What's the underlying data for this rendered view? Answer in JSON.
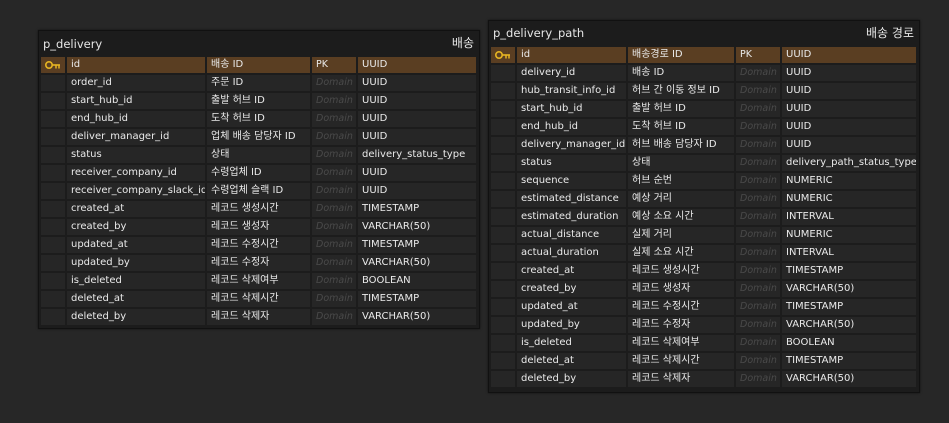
{
  "tables": [
    {
      "name": "p_delivery",
      "comment": "배송",
      "columns": [
        {
          "name": "id",
          "comment": "배송 ID",
          "key": "PK",
          "type": "UUID",
          "pk": true
        },
        {
          "name": "order_id",
          "comment": "주문 ID",
          "key": "Domain",
          "type": "UUID"
        },
        {
          "name": "start_hub_id",
          "comment": "출발 허브 ID",
          "key": "Domain",
          "type": "UUID"
        },
        {
          "name": "end_hub_id",
          "comment": "도착 허브 ID",
          "key": "Domain",
          "type": "UUID"
        },
        {
          "name": "deliver_manager_id",
          "comment": "업체 배송 담당자 ID",
          "key": "Domain",
          "type": "UUID"
        },
        {
          "name": "status",
          "comment": "상태",
          "key": "Domain",
          "type": "delivery_status_type"
        },
        {
          "name": "receiver_company_id",
          "comment": "수령업체 ID",
          "key": "Domain",
          "type": "UUID"
        },
        {
          "name": "receiver_company_slack_id",
          "comment": "수령업체 슬랙 ID",
          "key": "Domain",
          "type": "UUID"
        },
        {
          "name": "created_at",
          "comment": "레코드 생성시간",
          "key": "Domain",
          "type": "TIMESTAMP"
        },
        {
          "name": "created_by",
          "comment": "레코드 생성자",
          "key": "Domain",
          "type": "VARCHAR(50)"
        },
        {
          "name": "updated_at",
          "comment": "레코드 수정시간",
          "key": "Domain",
          "type": "TIMESTAMP"
        },
        {
          "name": "updated_by",
          "comment": "레코드 수정자",
          "key": "Domain",
          "type": "VARCHAR(50)"
        },
        {
          "name": "is_deleted",
          "comment": "레코드 삭제여부",
          "key": "Domain",
          "type": "BOOLEAN"
        },
        {
          "name": "deleted_at",
          "comment": "레코드 삭제시간",
          "key": "Domain",
          "type": "TIMESTAMP"
        },
        {
          "name": "deleted_by",
          "comment": "레코드 삭제자",
          "key": "Domain",
          "type": "VARCHAR(50)"
        }
      ]
    },
    {
      "name": "p_delivery_path",
      "comment": "배송 경로",
      "columns": [
        {
          "name": "id",
          "comment": "배송경로 ID",
          "key": "PK",
          "type": "UUID",
          "pk": true
        },
        {
          "name": "delivery_id",
          "comment": "배송 ID",
          "key": "Domain",
          "type": "UUID"
        },
        {
          "name": "hub_transit_info_id",
          "comment": "허브 간 이동 정보 ID",
          "key": "Domain",
          "type": "UUID"
        },
        {
          "name": "start_hub_id",
          "comment": "출발 허브 ID",
          "key": "Domain",
          "type": "UUID"
        },
        {
          "name": "end_hub_id",
          "comment": "도착 허브 ID",
          "key": "Domain",
          "type": "UUID"
        },
        {
          "name": "delivery_manager_id",
          "comment": "허브 배송 담당자 ID",
          "key": "Domain",
          "type": "UUID"
        },
        {
          "name": "status",
          "comment": "상태",
          "key": "Domain",
          "type": "delivery_path_status_type"
        },
        {
          "name": "sequence",
          "comment": "허브 순번",
          "key": "Domain",
          "type": "NUMERIC"
        },
        {
          "name": "estimated_distance",
          "comment": "예상 거리",
          "key": "Domain",
          "type": "NUMERIC"
        },
        {
          "name": "estimated_duration",
          "comment": "예상 소요 시간",
          "key": "Domain",
          "type": "INTERVAL"
        },
        {
          "name": "actual_distance",
          "comment": "실제 거리",
          "key": "Domain",
          "type": "NUMERIC"
        },
        {
          "name": "actual_duration",
          "comment": "실제 소요 시간",
          "key": "Domain",
          "type": "INTERVAL"
        },
        {
          "name": "created_at",
          "comment": "레코드 생성시간",
          "key": "Domain",
          "type": "TIMESTAMP"
        },
        {
          "name": "created_by",
          "comment": "레코드 생성자",
          "key": "Domain",
          "type": "VARCHAR(50)"
        },
        {
          "name": "updated_at",
          "comment": "레코드 수정시간",
          "key": "Domain",
          "type": "TIMESTAMP"
        },
        {
          "name": "updated_by",
          "comment": "레코드 수정자",
          "key": "Domain",
          "type": "VARCHAR(50)"
        },
        {
          "name": "is_deleted",
          "comment": "레코드 삭제여부",
          "key": "Domain",
          "type": "BOOLEAN"
        },
        {
          "name": "deleted_at",
          "comment": "레코드 삭제시간",
          "key": "Domain",
          "type": "TIMESTAMP"
        },
        {
          "name": "deleted_by",
          "comment": "레코드 삭제자",
          "key": "Domain",
          "type": "VARCHAR(50)"
        }
      ]
    }
  ],
  "icons": {
    "primary_key": "key-icon"
  },
  "colors": {
    "background": "#272727",
    "table": "#1c1c1c",
    "cell": "#262626",
    "pk_row": "#5a3e22",
    "key_icon": "#e6b422"
  }
}
